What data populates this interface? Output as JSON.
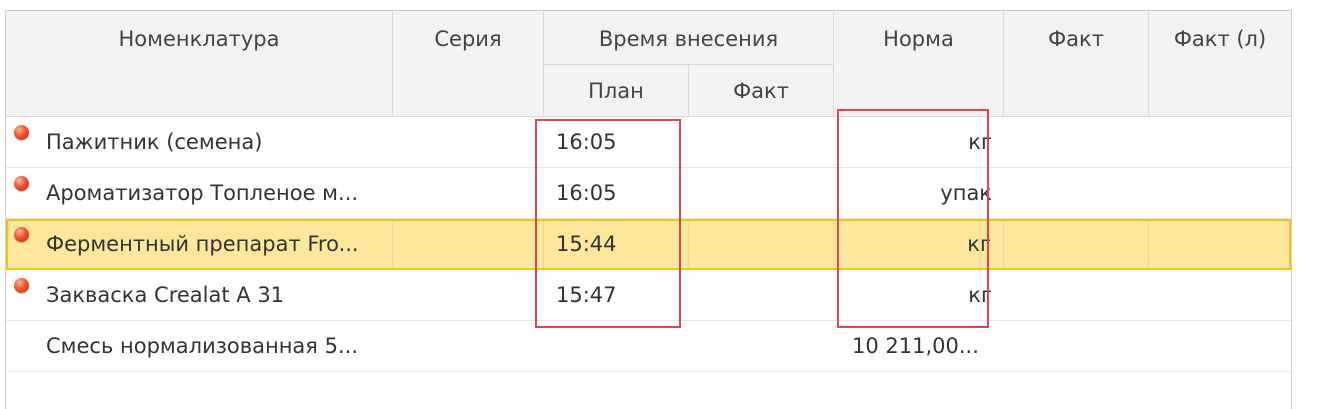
{
  "header": {
    "nomenclature": "Номенклатура",
    "series": "Серия",
    "time_group": "Время внесения",
    "time_plan": "План",
    "time_fact": "Факт",
    "norm": "Норма",
    "fact": "Факт",
    "fact_l": "Факт (л)"
  },
  "rows": [
    {
      "name": "Пажитник (семена)",
      "plan": "16:05",
      "norm": "кг",
      "marker": true,
      "selected": false
    },
    {
      "name": "Ароматизатор Топленое м...",
      "plan": "16:05",
      "norm": "упак",
      "marker": true,
      "selected": false
    },
    {
      "name": "Ферментный препарат Fro...",
      "plan": "15:44",
      "norm": "кг",
      "marker": true,
      "selected": true
    },
    {
      "name": "Закваска Crealat A 31",
      "plan": "15:47",
      "norm": "кг",
      "marker": true,
      "selected": false
    },
    {
      "name": "Смесь нормализованная 5...",
      "plan": "",
      "norm": "10 211,00...",
      "marker": false,
      "selected": false
    }
  ],
  "colors": {
    "header_bg": "#f2f2f2",
    "selected_row_bg": "#fce79a",
    "selected_row_border": "#f0c419",
    "highlight_box": "#e0474c",
    "marker": "#f0532e"
  },
  "icons": {
    "row_marker": "red-circle-icon"
  }
}
